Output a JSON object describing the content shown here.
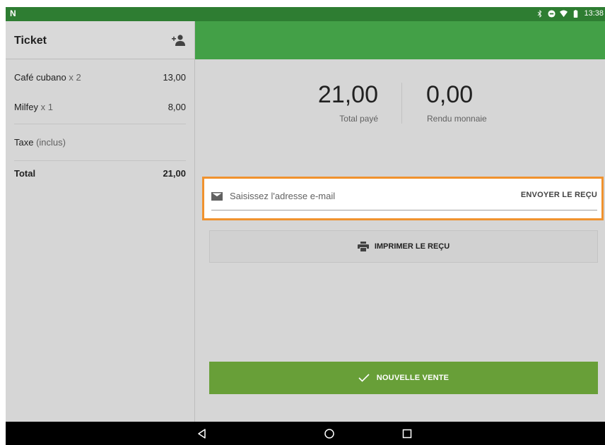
{
  "status_bar": {
    "time": "13:38",
    "icons": [
      "bluetooth-icon",
      "do-not-disturb-icon",
      "wifi-icon",
      "battery-icon"
    ]
  },
  "ticket": {
    "title": "Ticket",
    "add_customer_icon": "add-person-icon",
    "items": [
      {
        "name": "Café cubano",
        "qty": "x 2",
        "amount": "13,00"
      },
      {
        "name": "Milfey",
        "qty": "x 1",
        "amount": "8,00"
      }
    ],
    "tax_label": "Taxe",
    "tax_note": "(inclus)",
    "total_label": "Total",
    "total_amount": "21,00"
  },
  "payment": {
    "total_paid_value": "21,00",
    "total_paid_label": "Total payé",
    "change_value": "0,00",
    "change_label": "Rendu monnaie"
  },
  "email": {
    "placeholder": "Saisissez l'adresse e-mail",
    "value": "",
    "send_label": "ENVOYER LE REÇU",
    "icon": "email-icon"
  },
  "print": {
    "label": "IMPRIMER LE REÇU",
    "icon": "printer-icon"
  },
  "new_sale": {
    "label": "NOUVELLE VENTE",
    "icon": "check-icon"
  },
  "nav": {
    "icons": [
      "back-icon",
      "home-icon",
      "recents-icon"
    ]
  },
  "colors": {
    "status_bar": "#2e7d32",
    "header_green": "#43a047",
    "new_sale_green": "#689f38",
    "highlight": "#f0922e",
    "panel_bg": "#d6d6d6"
  }
}
